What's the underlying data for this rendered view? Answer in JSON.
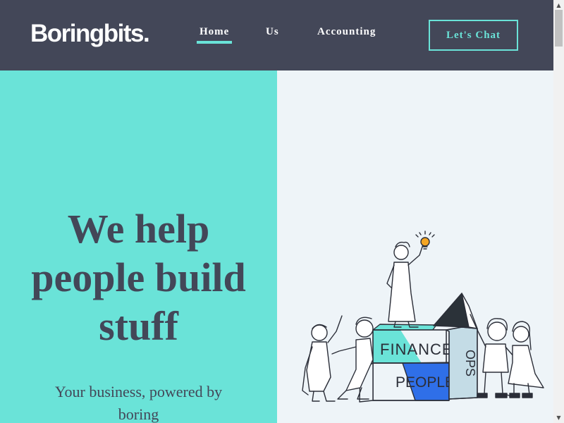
{
  "brand": {
    "logo_text": "Boringbits."
  },
  "nav": {
    "items": [
      {
        "label": "Home",
        "active": true
      },
      {
        "label": "Us",
        "active": false
      },
      {
        "label": "Accounting",
        "active": false
      }
    ],
    "cta_label": "Let's Chat"
  },
  "hero": {
    "title_lines": [
      "We help",
      "people build",
      "stuff"
    ],
    "subtitle_lines": [
      "Your business, powered by",
      "boring"
    ]
  },
  "illustration": {
    "block_labels": [
      "FINANCE",
      "PEOPLE",
      "OPS"
    ]
  },
  "colors": {
    "header_bg": "#434758",
    "accent": "#6ae3d8",
    "text_dark": "#434758",
    "illustration_bg": "#eef4f8",
    "block_blue": "#2f6fe8",
    "bulb": "#f5a623"
  }
}
